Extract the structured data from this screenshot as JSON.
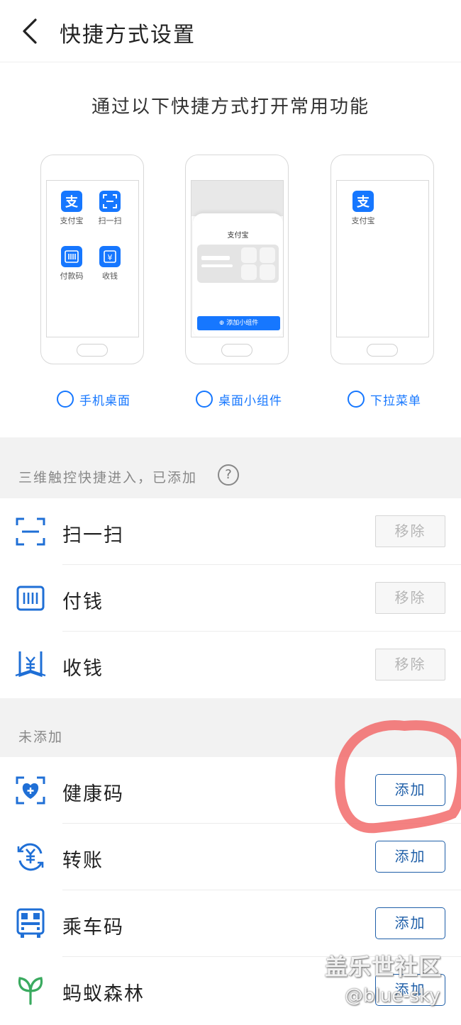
{
  "header": {
    "title": "快捷方式设置"
  },
  "intro": "通过以下快捷方式打开常用功能",
  "preview_desktop": {
    "apps": [
      {
        "label": "支付宝"
      },
      {
        "label": "扫一扫"
      },
      {
        "label": "付款码"
      },
      {
        "label": "收钱"
      }
    ]
  },
  "preview_widget": {
    "title": "支付宝",
    "add_label": "添加小组件"
  },
  "preview_pulldown": {
    "app_label": "支付宝"
  },
  "options": [
    {
      "label": "手机桌面"
    },
    {
      "label": "桌面小组件"
    },
    {
      "label": "下拉菜单"
    }
  ],
  "added_section": {
    "title": "三维触控快捷进入，已添加",
    "help_symbol": "?",
    "items": [
      {
        "label": "扫一扫",
        "icon": "scan-icon",
        "action": "移除"
      },
      {
        "label": "付钱",
        "icon": "barcode-icon",
        "action": "移除"
      },
      {
        "label": "收钱",
        "icon": "yuan-receive-icon",
        "action": "移除"
      }
    ]
  },
  "not_added_section": {
    "title": "未添加",
    "items": [
      {
        "label": "健康码",
        "icon": "health-code-icon",
        "action": "添加"
      },
      {
        "label": "转账",
        "icon": "transfer-icon",
        "action": "添加"
      },
      {
        "label": "乘车码",
        "icon": "bus-code-icon",
        "action": "添加"
      },
      {
        "label": "蚂蚁森林",
        "icon": "ant-forest-icon",
        "action": "添加"
      }
    ]
  },
  "watermark": {
    "line1": "盖乐世社区",
    "line2": "@blue-sky"
  },
  "colors": {
    "accent": "#1677ff",
    "button_border": "#1f5fa8",
    "icon_blue": "#1f6fd6",
    "annotation": "#f26b6b",
    "forest_green": "#3aaa5f"
  }
}
